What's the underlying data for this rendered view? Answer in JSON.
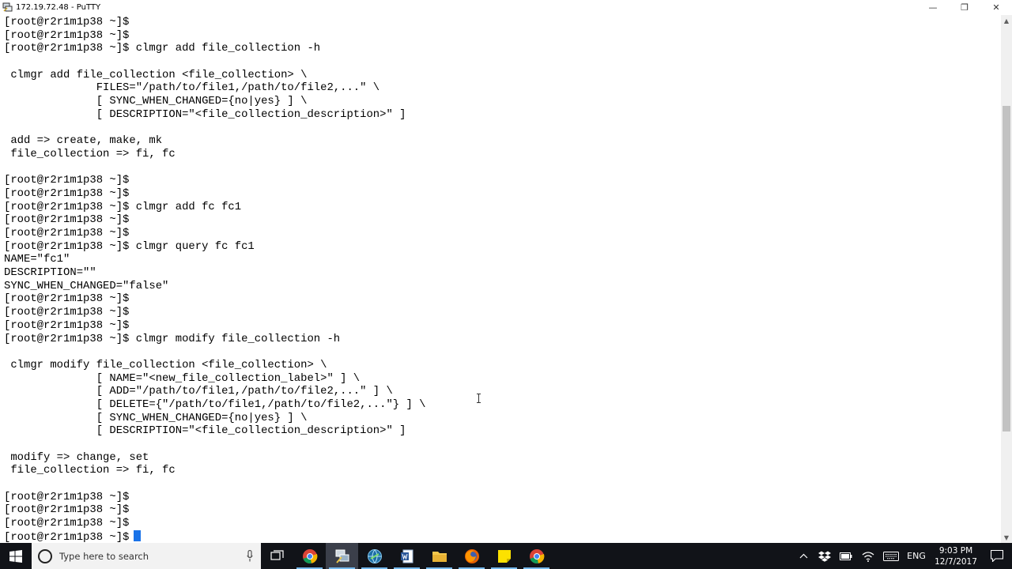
{
  "window": {
    "title": "172.19.72.48 - PuTTY",
    "minimize_glyph": "—",
    "restore_glyph": "❐",
    "close_glyph": "✕"
  },
  "terminal": {
    "lines": [
      "[root@r2r1m1p38 ~]$",
      "[root@r2r1m1p38 ~]$",
      "[root@r2r1m1p38 ~]$ clmgr add file_collection -h",
      "",
      " clmgr add file_collection <file_collection> \\",
      "              FILES=\"/path/to/file1,/path/to/file2,...\" \\",
      "              [ SYNC_WHEN_CHANGED={no|yes} ] \\",
      "              [ DESCRIPTION=\"<file_collection_description>\" ]",
      "",
      " add => create, make, mk",
      " file_collection => fi, fc",
      "",
      "[root@r2r1m1p38 ~]$",
      "[root@r2r1m1p38 ~]$",
      "[root@r2r1m1p38 ~]$ clmgr add fc fc1",
      "[root@r2r1m1p38 ~]$",
      "[root@r2r1m1p38 ~]$",
      "[root@r2r1m1p38 ~]$ clmgr query fc fc1",
      "NAME=\"fc1\"",
      "DESCRIPTION=\"\"",
      "SYNC_WHEN_CHANGED=\"false\"",
      "[root@r2r1m1p38 ~]$",
      "[root@r2r1m1p38 ~]$",
      "[root@r2r1m1p38 ~]$",
      "[root@r2r1m1p38 ~]$ clmgr modify file_collection -h",
      "",
      " clmgr modify file_collection <file_collection> \\",
      "              [ NAME=\"<new_file_collection_label>\" ] \\",
      "              [ ADD=\"/path/to/file1,/path/to/file2,...\" ] \\",
      "              [ DELETE={\"/path/to/file1,/path/to/file2,...\"} ] \\",
      "              [ SYNC_WHEN_CHANGED={no|yes} ] \\",
      "              [ DESCRIPTION=\"<file_collection_description>\" ]",
      "",
      " modify => change, set",
      " file_collection => fi, fc",
      "",
      "[root@r2r1m1p38 ~]$",
      "[root@r2r1m1p38 ~]$",
      "[root@r2r1m1p38 ~]$",
      "[root@r2r1m1p38 ~]$"
    ],
    "scroll_position": 0.42
  },
  "taskbar": {
    "search_placeholder": "Type here to search",
    "apps": [
      {
        "name": "task-view",
        "active": false,
        "running": false
      },
      {
        "name": "chrome",
        "active": false,
        "running": true
      },
      {
        "name": "putty",
        "active": true,
        "running": true
      },
      {
        "name": "network-globe",
        "active": false,
        "running": true
      },
      {
        "name": "office",
        "active": false,
        "running": true
      },
      {
        "name": "file-explorer",
        "active": false,
        "running": true
      },
      {
        "name": "firefox",
        "active": false,
        "running": true
      },
      {
        "name": "sticky-notes",
        "active": false,
        "running": true
      },
      {
        "name": "chrome-second",
        "active": false,
        "running": true
      }
    ],
    "tray": {
      "language": "ENG",
      "time": "9:03 PM",
      "date": "12/7/2017"
    }
  },
  "colors": {
    "terminal_bg": "#ffffff",
    "terminal_fg": "#000000",
    "cursor": "#1a73e8",
    "taskbar_bg": "#111318"
  }
}
